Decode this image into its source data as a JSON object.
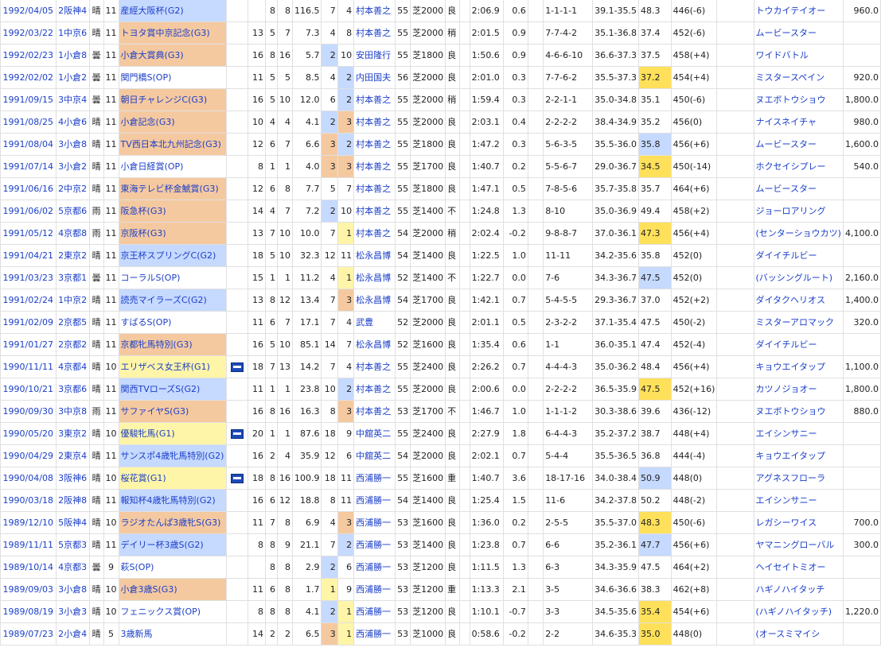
{
  "rows": [
    {
      "date": "1992/04/05",
      "venue": "2阪神4",
      "weather": "晴",
      "rno": "11",
      "race": "産經大阪杯(G2)",
      "grade": "g2",
      "flag": false,
      "hc": "",
      "waku": "8",
      "uma": "8",
      "odds": "116.5",
      "pop": "7",
      "pop_hl": "",
      "rank": "4",
      "rank_hl": "",
      "jockey": "村本善之",
      "wt": "55",
      "dist": "芝2000",
      "cond": "良",
      "time": "2:06.9",
      "diff": "0.6",
      "pass": "1-1-1-1",
      "pace": "39.1-35.5",
      "last3f": "48.3",
      "last3f_hl": "",
      "bw": "446(-6)",
      "winner": "トウカイテイオー",
      "prize": "960.0"
    },
    {
      "date": "1992/03/22",
      "venue": "1中京6",
      "weather": "晴",
      "rno": "11",
      "race": "トヨタ賞中京記念(G3)",
      "grade": "g3",
      "flag": false,
      "hc": "13",
      "waku": "5",
      "uma": "7",
      "odds": "7.3",
      "pop": "4",
      "pop_hl": "",
      "rank": "8",
      "rank_hl": "",
      "jockey": "村本善之",
      "wt": "55",
      "dist": "芝2000",
      "cond": "稍",
      "time": "2:01.5",
      "diff": "0.9",
      "pass": "7-7-4-2",
      "pace": "35.1-36.8",
      "last3f": "37.4",
      "last3f_hl": "",
      "bw": "452(-6)",
      "winner": "ムービースター",
      "prize": ""
    },
    {
      "date": "1992/02/23",
      "venue": "1小倉8",
      "weather": "曇",
      "rno": "11",
      "race": "小倉大賞典(G3)",
      "grade": "g3",
      "flag": false,
      "hc": "16",
      "waku": "8",
      "uma": "16",
      "odds": "5.7",
      "pop": "2",
      "pop_hl": "blue",
      "rank": "10",
      "rank_hl": "",
      "jockey": "安田隆行",
      "wt": "55",
      "dist": "芝1800",
      "cond": "良",
      "time": "1:50.6",
      "diff": "0.9",
      "pass": "4-6-6-10",
      "pace": "36.6-37.3",
      "last3f": "37.5",
      "last3f_hl": "",
      "bw": "458(+4)",
      "winner": "ワイドバトル",
      "prize": ""
    },
    {
      "date": "1992/02/02",
      "venue": "1小倉2",
      "weather": "曇",
      "rno": "11",
      "race": "関門橋S(OP)",
      "grade": "",
      "flag": false,
      "hc": "11",
      "waku": "5",
      "uma": "5",
      "odds": "8.5",
      "pop": "4",
      "pop_hl": "",
      "rank": "2",
      "rank_hl": "blue",
      "jockey": "内田国夫",
      "wt": "56",
      "dist": "芝2000",
      "cond": "良",
      "time": "2:01.0",
      "diff": "0.3",
      "pass": "7-7-6-2",
      "pace": "35.5-37.3",
      "last3f": "37.2",
      "last3f_hl": "hl",
      "bw": "454(+4)",
      "winner": "ミスタースペイン",
      "prize": "920.0"
    },
    {
      "date": "1991/09/15",
      "venue": "3中京4",
      "weather": "曇",
      "rno": "11",
      "race": "朝日チャレンジC(G3)",
      "grade": "g3",
      "flag": false,
      "hc": "16",
      "waku": "5",
      "uma": "10",
      "odds": "12.0",
      "pop": "6",
      "pop_hl": "",
      "rank": "2",
      "rank_hl": "blue",
      "jockey": "村本善之",
      "wt": "55",
      "dist": "芝2000",
      "cond": "稍",
      "time": "1:59.4",
      "diff": "0.3",
      "pass": "2-2-1-1",
      "pace": "35.0-34.8",
      "last3f": "35.1",
      "last3f_hl": "",
      "bw": "450(-6)",
      "winner": "ヌエボトウショウ",
      "prize": "1,800.0"
    },
    {
      "date": "1991/08/25",
      "venue": "4小倉6",
      "weather": "晴",
      "rno": "11",
      "race": "小倉記念(G3)",
      "grade": "g3",
      "flag": false,
      "hc": "10",
      "waku": "4",
      "uma": "4",
      "odds": "4.1",
      "pop": "2",
      "pop_hl": "blue",
      "rank": "3",
      "rank_hl": "g3",
      "jockey": "村本善之",
      "wt": "55",
      "dist": "芝2000",
      "cond": "良",
      "time": "2:03.1",
      "diff": "0.4",
      "pass": "2-2-2-2",
      "pace": "38.4-34.9",
      "last3f": "35.2",
      "last3f_hl": "",
      "bw": "456(0)",
      "winner": "ナイスネイチャ",
      "prize": "980.0"
    },
    {
      "date": "1991/08/04",
      "venue": "3小倉8",
      "weather": "晴",
      "rno": "11",
      "race": "TV西日本北九州記念(G3)",
      "grade": "g3",
      "flag": false,
      "hc": "12",
      "waku": "6",
      "uma": "7",
      "odds": "6.6",
      "pop": "3",
      "pop_hl": "g3",
      "rank": "2",
      "rank_hl": "blue",
      "jockey": "村本善之",
      "wt": "55",
      "dist": "芝1800",
      "cond": "良",
      "time": "1:47.2",
      "diff": "0.3",
      "pass": "5-6-3-5",
      "pace": "35.5-36.0",
      "last3f": "35.8",
      "last3f_hl": "blue",
      "bw": "456(+6)",
      "winner": "ムービースター",
      "prize": "1,600.0"
    },
    {
      "date": "1991/07/14",
      "venue": "3小倉2",
      "weather": "晴",
      "rno": "11",
      "race": "小倉日経賞(OP)",
      "grade": "",
      "flag": false,
      "hc": "8",
      "waku": "1",
      "uma": "1",
      "odds": "4.0",
      "pop": "3",
      "pop_hl": "g3",
      "rank": "3",
      "rank_hl": "g3",
      "jockey": "村本善之",
      "wt": "55",
      "dist": "芝1700",
      "cond": "良",
      "time": "1:40.7",
      "diff": "0.2",
      "pass": "5-5-6-7",
      "pace": "29.0-36.7",
      "last3f": "34.5",
      "last3f_hl": "hl",
      "bw": "450(-14)",
      "winner": "ホクセイシプレー",
      "prize": "540.0"
    },
    {
      "date": "1991/06/16",
      "venue": "2中京2",
      "weather": "晴",
      "rno": "11",
      "race": "東海テレビ杯金鯱賞(G3)",
      "grade": "g3",
      "flag": false,
      "hc": "12",
      "waku": "6",
      "uma": "8",
      "odds": "7.7",
      "pop": "5",
      "pop_hl": "",
      "rank": "7",
      "rank_hl": "",
      "jockey": "村本善之",
      "wt": "55",
      "dist": "芝1800",
      "cond": "良",
      "time": "1:47.1",
      "diff": "0.5",
      "pass": "7-8-5-6",
      "pace": "35.7-35.8",
      "last3f": "35.7",
      "last3f_hl": "",
      "bw": "464(+6)",
      "winner": "ムービースター",
      "prize": ""
    },
    {
      "date": "1991/06/02",
      "venue": "5京都6",
      "weather": "雨",
      "rno": "11",
      "race": "阪急杯(G3)",
      "grade": "g3",
      "flag": false,
      "hc": "14",
      "waku": "4",
      "uma": "7",
      "odds": "7.2",
      "pop": "2",
      "pop_hl": "blue",
      "rank": "10",
      "rank_hl": "",
      "jockey": "村本善之",
      "wt": "55",
      "dist": "芝1400",
      "cond": "不",
      "time": "1:24.8",
      "diff": "1.3",
      "pass": "8-10",
      "pace": "35.0-36.9",
      "last3f": "49.4",
      "last3f_hl": "",
      "bw": "458(+2)",
      "winner": "ジョーロアリング",
      "prize": ""
    },
    {
      "date": "1991/05/12",
      "venue": "4京都8",
      "weather": "雨",
      "rno": "11",
      "race": "京阪杯(G3)",
      "grade": "g3",
      "flag": false,
      "hc": "13",
      "waku": "7",
      "uma": "10",
      "odds": "10.0",
      "pop": "7",
      "pop_hl": "",
      "rank": "1",
      "rank_hl": "g1",
      "jockey": "村本善之",
      "wt": "54",
      "dist": "芝2000",
      "cond": "稍",
      "time": "2:02.4",
      "diff": "-0.2",
      "pass": "9-8-8-7",
      "pace": "37.0-36.1",
      "last3f": "47.3",
      "last3f_hl": "hl",
      "bw": "456(+4)",
      "winner": "(センターショウカツ)",
      "prize": "4,100.0"
    },
    {
      "date": "1991/04/21",
      "venue": "2東京2",
      "weather": "晴",
      "rno": "11",
      "race": "京王杯スプリングC(G2)",
      "grade": "g2",
      "flag": false,
      "hc": "18",
      "waku": "5",
      "uma": "10",
      "odds": "32.3",
      "pop": "12",
      "pop_hl": "",
      "rank": "11",
      "rank_hl": "",
      "jockey": "松永昌博",
      "wt": "54",
      "dist": "芝1400",
      "cond": "良",
      "time": "1:22.5",
      "diff": "1.0",
      "pass": "11-11",
      "pace": "34.2-35.6",
      "last3f": "35.8",
      "last3f_hl": "",
      "bw": "452(0)",
      "winner": "ダイイチルビー",
      "prize": ""
    },
    {
      "date": "1991/03/23",
      "venue": "3京都1",
      "weather": "曇",
      "rno": "11",
      "race": "コーラルS(OP)",
      "grade": "",
      "flag": false,
      "hc": "15",
      "waku": "1",
      "uma": "1",
      "odds": "11.2",
      "pop": "4",
      "pop_hl": "",
      "rank": "1",
      "rank_hl": "g1",
      "jockey": "松永昌博",
      "wt": "52",
      "dist": "芝1400",
      "cond": "不",
      "time": "1:22.7",
      "diff": "0.0",
      "pass": "7-6",
      "pace": "34.3-36.7",
      "last3f": "47.5",
      "last3f_hl": "blue",
      "bw": "452(0)",
      "winner": "(バッシングルート)",
      "prize": "2,160.0"
    },
    {
      "date": "1991/02/24",
      "venue": "1中京2",
      "weather": "晴",
      "rno": "11",
      "race": "読売マイラーズC(G2)",
      "grade": "g2",
      "flag": false,
      "hc": "13",
      "waku": "8",
      "uma": "12",
      "odds": "13.4",
      "pop": "7",
      "pop_hl": "",
      "rank": "3",
      "rank_hl": "g3",
      "jockey": "松永昌博",
      "wt": "54",
      "dist": "芝1700",
      "cond": "良",
      "time": "1:42.1",
      "diff": "0.7",
      "pass": "5-4-5-5",
      "pace": "29.3-36.7",
      "last3f": "37.0",
      "last3f_hl": "",
      "bw": "452(+2)",
      "winner": "ダイタクヘリオス",
      "prize": "1,400.0"
    },
    {
      "date": "1991/02/09",
      "venue": "2京都5",
      "weather": "晴",
      "rno": "11",
      "race": "すばるS(OP)",
      "grade": "",
      "flag": false,
      "hc": "11",
      "waku": "6",
      "uma": "7",
      "odds": "17.1",
      "pop": "7",
      "pop_hl": "",
      "rank": "4",
      "rank_hl": "",
      "jockey": "武豊",
      "wt": "52",
      "dist": "芝2000",
      "cond": "良",
      "time": "2:01.1",
      "diff": "0.5",
      "pass": "2-3-2-2",
      "pace": "37.1-35.4",
      "last3f": "47.5",
      "last3f_hl": "",
      "bw": "450(-2)",
      "winner": "ミスターアロマック",
      "prize": "320.0"
    },
    {
      "date": "1991/01/27",
      "venue": "2京都2",
      "weather": "晴",
      "rno": "11",
      "race": "京都牝馬特別(G3)",
      "grade": "g3",
      "flag": false,
      "hc": "16",
      "waku": "5",
      "uma": "10",
      "odds": "85.1",
      "pop": "14",
      "pop_hl": "",
      "rank": "7",
      "rank_hl": "",
      "jockey": "松永昌博",
      "wt": "52",
      "dist": "芝1600",
      "cond": "良",
      "time": "1:35.4",
      "diff": "0.6",
      "pass": "1-1",
      "pace": "36.0-35.1",
      "last3f": "47.4",
      "last3f_hl": "",
      "bw": "452(-4)",
      "winner": "ダイイチルビー",
      "prize": ""
    },
    {
      "date": "1990/11/11",
      "venue": "4京都4",
      "weather": "晴",
      "rno": "10",
      "race": "エリザベス女王杯(G1)",
      "grade": "g1",
      "flag": true,
      "hc": "18",
      "waku": "7",
      "uma": "13",
      "odds": "14.2",
      "pop": "7",
      "pop_hl": "",
      "rank": "4",
      "rank_hl": "",
      "jockey": "村本善之",
      "wt": "55",
      "dist": "芝2400",
      "cond": "良",
      "time": "2:26.2",
      "diff": "0.7",
      "pass": "4-4-4-3",
      "pace": "35.0-36.2",
      "last3f": "48.4",
      "last3f_hl": "",
      "bw": "456(+4)",
      "winner": "キョウエイタップ",
      "prize": "1,100.0"
    },
    {
      "date": "1990/10/21",
      "venue": "3京都6",
      "weather": "晴",
      "rno": "11",
      "race": "関西TVローズS(G2)",
      "grade": "g2",
      "flag": false,
      "hc": "11",
      "waku": "1",
      "uma": "1",
      "odds": "23.8",
      "pop": "10",
      "pop_hl": "",
      "rank": "2",
      "rank_hl": "blue",
      "jockey": "村本善之",
      "wt": "55",
      "dist": "芝2000",
      "cond": "良",
      "time": "2:00.6",
      "diff": "0.0",
      "pass": "2-2-2-2",
      "pace": "36.5-35.9",
      "last3f": "47.5",
      "last3f_hl": "hl",
      "bw": "452(+16)",
      "winner": "カツノジョオー",
      "prize": "1,800.0"
    },
    {
      "date": "1990/09/30",
      "venue": "3中京8",
      "weather": "雨",
      "rno": "11",
      "race": "サファイヤS(G3)",
      "grade": "g3",
      "flag": false,
      "hc": "16",
      "waku": "8",
      "uma": "16",
      "odds": "16.3",
      "pop": "8",
      "pop_hl": "",
      "rank": "3",
      "rank_hl": "g3",
      "jockey": "村本善之",
      "wt": "53",
      "dist": "芝1700",
      "cond": "不",
      "time": "1:46.7",
      "diff": "1.0",
      "pass": "1-1-1-2",
      "pace": "30.3-38.6",
      "last3f": "39.6",
      "last3f_hl": "",
      "bw": "436(-12)",
      "winner": "ヌエボトウショウ",
      "prize": "880.0"
    },
    {
      "date": "1990/05/20",
      "venue": "3東京2",
      "weather": "晴",
      "rno": "10",
      "race": "優駿牝馬(G1)",
      "grade": "g1",
      "flag": true,
      "hc": "20",
      "waku": "1",
      "uma": "1",
      "odds": "87.6",
      "pop": "18",
      "pop_hl": "",
      "rank": "9",
      "rank_hl": "",
      "jockey": "中舘英二",
      "wt": "55",
      "dist": "芝2400",
      "cond": "良",
      "time": "2:27.9",
      "diff": "1.8",
      "pass": "6-4-4-3",
      "pace": "35.2-37.2",
      "last3f": "38.7",
      "last3f_hl": "",
      "bw": "448(+4)",
      "winner": "エイシンサニー",
      "prize": ""
    },
    {
      "date": "1990/04/29",
      "venue": "2東京4",
      "weather": "晴",
      "rno": "11",
      "race": "サンスポ4歳牝馬特別(G2)",
      "grade": "g2",
      "flag": false,
      "hc": "16",
      "waku": "2",
      "uma": "4",
      "odds": "35.9",
      "pop": "12",
      "pop_hl": "",
      "rank": "6",
      "rank_hl": "",
      "jockey": "中舘英二",
      "wt": "54",
      "dist": "芝2000",
      "cond": "良",
      "time": "2:02.1",
      "diff": "0.7",
      "pass": "5-4-4",
      "pace": "35.5-36.5",
      "last3f": "36.8",
      "last3f_hl": "",
      "bw": "444(-4)",
      "winner": "キョウエイタップ",
      "prize": ""
    },
    {
      "date": "1990/04/08",
      "venue": "3阪神6",
      "weather": "晴",
      "rno": "10",
      "race": "桜花賞(G1)",
      "grade": "g1",
      "flag": true,
      "hc": "18",
      "waku": "8",
      "uma": "16",
      "odds": "100.9",
      "pop": "18",
      "pop_hl": "",
      "rank": "11",
      "rank_hl": "",
      "jockey": "西浦勝一",
      "wt": "55",
      "dist": "芝1600",
      "cond": "重",
      "time": "1:40.7",
      "diff": "3.6",
      "pass": "18-17-16",
      "pace": "34.0-38.4",
      "last3f": "50.9",
      "last3f_hl": "blue",
      "bw": "448(0)",
      "winner": "アグネスフローラ",
      "prize": ""
    },
    {
      "date": "1990/03/18",
      "venue": "2阪神8",
      "weather": "晴",
      "rno": "11",
      "race": "報知杯4歳牝馬特別(G2)",
      "grade": "g2",
      "flag": false,
      "hc": "16",
      "waku": "6",
      "uma": "12",
      "odds": "18.8",
      "pop": "8",
      "pop_hl": "",
      "rank": "11",
      "rank_hl": "",
      "jockey": "西浦勝一",
      "wt": "54",
      "dist": "芝1400",
      "cond": "良",
      "time": "1:25.4",
      "diff": "1.5",
      "pass": "11-6",
      "pace": "34.2-37.8",
      "last3f": "50.2",
      "last3f_hl": "",
      "bw": "448(-2)",
      "winner": "エイシンサニー",
      "prize": ""
    },
    {
      "date": "1989/12/10",
      "venue": "5阪神4",
      "weather": "晴",
      "rno": "10",
      "race": "ラジオたんぱ3歳牝S(G3)",
      "grade": "g3",
      "flag": false,
      "hc": "11",
      "waku": "7",
      "uma": "8",
      "odds": "6.9",
      "pop": "4",
      "pop_hl": "",
      "rank": "3",
      "rank_hl": "g3",
      "jockey": "西浦勝一",
      "wt": "53",
      "dist": "芝1600",
      "cond": "良",
      "time": "1:36.0",
      "diff": "0.2",
      "pass": "2-5-5",
      "pace": "35.5-37.0",
      "last3f": "48.3",
      "last3f_hl": "hl",
      "bw": "450(-6)",
      "winner": "レガシーワイス",
      "prize": "700.0"
    },
    {
      "date": "1989/11/11",
      "venue": "5京都3",
      "weather": "晴",
      "rno": "11",
      "race": "デイリー杯3歳S(G2)",
      "grade": "g2",
      "flag": false,
      "hc": "8",
      "waku": "8",
      "uma": "9",
      "odds": "21.1",
      "pop": "7",
      "pop_hl": "",
      "rank": "2",
      "rank_hl": "blue",
      "jockey": "西浦勝一",
      "wt": "53",
      "dist": "芝1400",
      "cond": "良",
      "time": "1:23.8",
      "diff": "0.7",
      "pass": "6-6",
      "pace": "35.2-36.1",
      "last3f": "47.7",
      "last3f_hl": "blue",
      "bw": "456(+6)",
      "winner": "ヤマニングローバル",
      "prize": "300.0"
    },
    {
      "date": "1989/10/14",
      "venue": "4京都3",
      "weather": "曇",
      "rno": "9",
      "race": "萩S(OP)",
      "grade": "",
      "flag": false,
      "hc": "",
      "waku": "8",
      "uma": "8",
      "odds": "2.9",
      "pop": "2",
      "pop_hl": "blue",
      "rank": "6",
      "rank_hl": "",
      "jockey": "西浦勝一",
      "wt": "53",
      "dist": "芝1200",
      "cond": "良",
      "time": "1:11.5",
      "diff": "1.3",
      "pass": "6-3",
      "pace": "34.3-35.9",
      "last3f": "47.5",
      "last3f_hl": "",
      "bw": "464(+2)",
      "winner": "ヘイセイトミオー",
      "prize": ""
    },
    {
      "date": "1989/09/03",
      "venue": "3小倉8",
      "weather": "晴",
      "rno": "10",
      "race": "小倉3歳S(G3)",
      "grade": "g3",
      "flag": false,
      "hc": "11",
      "waku": "6",
      "uma": "8",
      "odds": "1.7",
      "pop": "1",
      "pop_hl": "g1",
      "rank": "9",
      "rank_hl": "",
      "jockey": "西浦勝一",
      "wt": "53",
      "dist": "芝1200",
      "cond": "重",
      "time": "1:13.3",
      "diff": "2.1",
      "pass": "3-5",
      "pace": "34.6-36.6",
      "last3f": "38.3",
      "last3f_hl": "",
      "bw": "462(+8)",
      "winner": "ハギノハイタッチ",
      "prize": ""
    },
    {
      "date": "1989/08/19",
      "venue": "3小倉3",
      "weather": "晴",
      "rno": "10",
      "race": "フェニックス賞(OP)",
      "grade": "",
      "flag": false,
      "hc": "8",
      "waku": "8",
      "uma": "8",
      "odds": "4.1",
      "pop": "2",
      "pop_hl": "blue",
      "rank": "1",
      "rank_hl": "g1",
      "jockey": "西浦勝一",
      "wt": "53",
      "dist": "芝1200",
      "cond": "良",
      "time": "1:10.1",
      "diff": "-0.7",
      "pass": "3-3",
      "pace": "34.5-35.6",
      "last3f": "35.4",
      "last3f_hl": "hl",
      "bw": "454(+6)",
      "winner": "(ハギノハイタッチ)",
      "prize": "1,220.0"
    },
    {
      "date": "1989/07/23",
      "venue": "2小倉4",
      "weather": "晴",
      "rno": "5",
      "race": "3歳新馬",
      "grade": "",
      "flag": false,
      "hc": "14",
      "waku": "2",
      "uma": "2",
      "odds": "6.5",
      "pop": "3",
      "pop_hl": "g3",
      "rank": "1",
      "rank_hl": "g1",
      "jockey": "西浦勝一",
      "wt": "53",
      "dist": "芝1000",
      "cond": "良",
      "time": "0:58.6",
      "diff": "-0.2",
      "pass": "2-2",
      "pace": "34.6-35.3",
      "last3f": "35.0",
      "last3f_hl": "hl",
      "bw": "448(0)",
      "winner": "(オースミマイシ",
      "prize": ""
    }
  ]
}
